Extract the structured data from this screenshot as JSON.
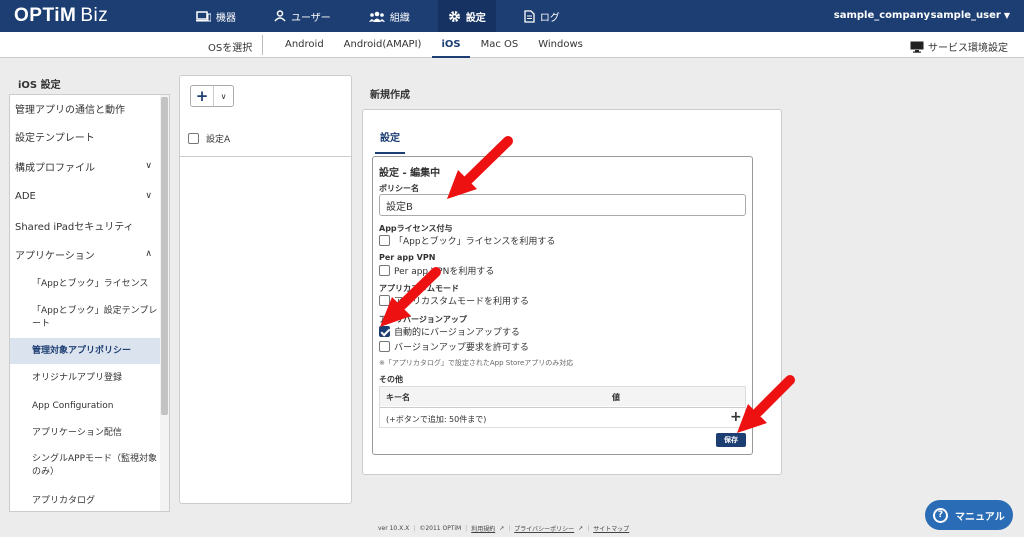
{
  "header": {
    "logo_brand": "OPTiM",
    "logo_product": "Biz",
    "nav": [
      {
        "label": "機器",
        "icon": "devices-icon"
      },
      {
        "label": "ユーザー",
        "icon": "user-icon"
      },
      {
        "label": "組織",
        "icon": "organization-icon"
      },
      {
        "label": "設定",
        "icon": "gear-icon",
        "active": true
      },
      {
        "label": "ログ",
        "icon": "log-icon"
      }
    ],
    "company": "sample_company",
    "user": "sample_user",
    "user_caret": "▼"
  },
  "os_bar": {
    "select_label": "OSを選択",
    "tabs": [
      "Android",
      "Android(AMAPI)",
      "iOS",
      "Mac OS",
      "Windows"
    ],
    "active_tab": "iOS",
    "service_settings": "サービス環境設定"
  },
  "sidebar": {
    "title": "iOS 設定",
    "items": [
      {
        "label": "管理アプリの通信と動作"
      },
      {
        "label": "設定テンプレート"
      },
      {
        "label": "構成プロファイル",
        "chevron": "∨"
      },
      {
        "label": "ADE",
        "chevron": "∨"
      },
      {
        "label": "Shared iPadセキュリティ"
      },
      {
        "label": "アプリケーション",
        "chevron": "∧"
      },
      {
        "label": "「Appとブック」ライセンス"
      },
      {
        "label": "「Appとブック」設定テンプレート"
      },
      {
        "label": "管理対象アプリポリシー",
        "active": true
      },
      {
        "label": "オリジナルアプリ登録"
      },
      {
        "label": "App Configuration"
      },
      {
        "label": "アプリケーション配信"
      },
      {
        "label": "シングルAPPモード（監視対象のみ）"
      },
      {
        "label": "アプリカタログ"
      }
    ]
  },
  "list": {
    "add_symbol": "+",
    "dropdown_symbol": "∨",
    "rows": [
      {
        "label": "設定A",
        "checked": false
      }
    ]
  },
  "form": {
    "page_title": "新規作成",
    "tab": "設定",
    "section_title": "設定 - 編集中",
    "policy_name_label": "ポリシー名",
    "policy_name_value": "設定B",
    "app_license_label": "Appライセンス付与",
    "app_license_option": "「Appとブック」ライセンスを利用する",
    "per_app_vpn_label": "Per app VPN",
    "per_app_vpn_option": "Per app VPNを利用する",
    "app_custom_label": "アプリカスタムモード",
    "app_custom_option": "アプリカスタムモードを利用する",
    "app_version_label": "アプリバージョンアップ",
    "auto_update_option": "自動的にバージョンアップする",
    "auto_update_checked": true,
    "allow_update_option": "バージョンアップ要求を許可する",
    "allow_update_checked": false,
    "note": "※「アプリカタログ」で設定されたApp Storeアプリのみ対応",
    "other_label": "その他",
    "key_header": "キー名",
    "value_header": "値",
    "add_hint": "(+ボタンで追加: 50件まで)",
    "add_symbol": "+",
    "save_button": "保存"
  },
  "footer": {
    "version": "ver 10.X.X",
    "copyright": "©2011 OPTiM",
    "terms": "利用規約",
    "privacy": "プライバシーポリシー",
    "sitemap": "サイトマップ"
  },
  "manual_button": {
    "icon": "?",
    "label": "マニュアル"
  },
  "colors": {
    "header": "#1d3e73",
    "accent": "#1d3e73",
    "annotation_arrow": "#ee1111",
    "manual_button": "#2b6cb6"
  }
}
